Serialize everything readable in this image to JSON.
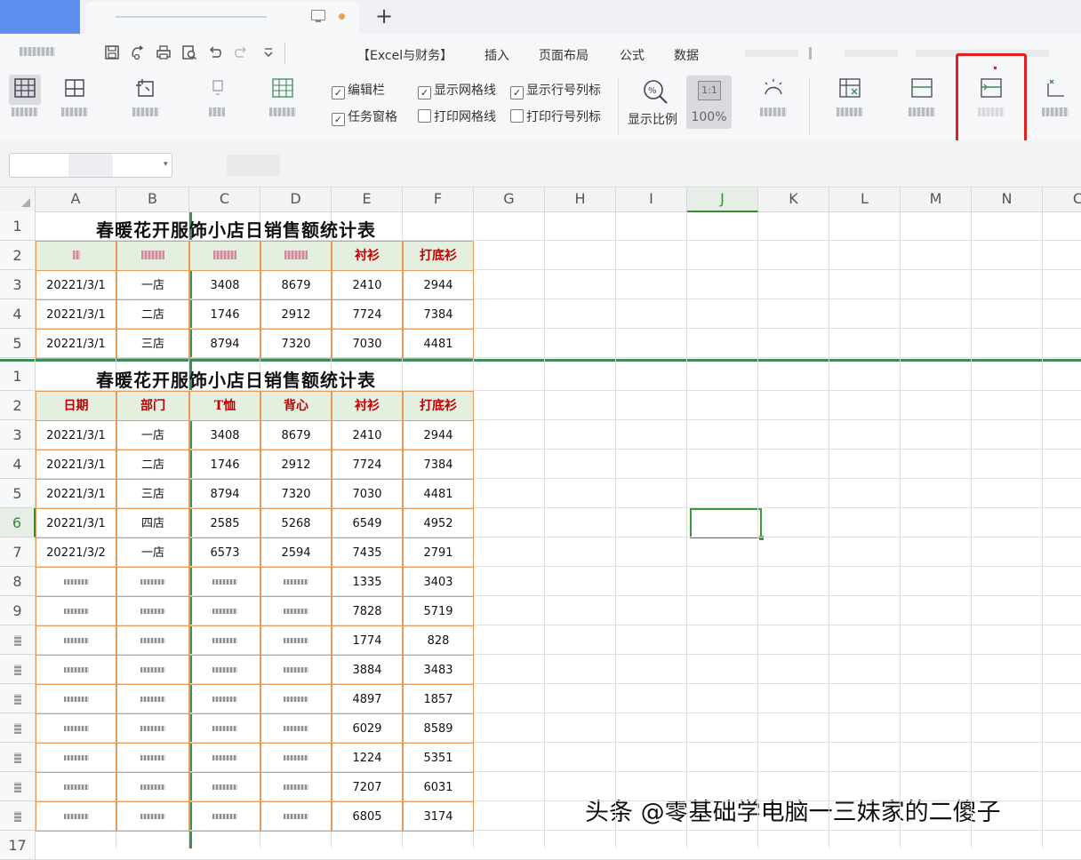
{
  "tabbar": {
    "new_tab": "+"
  },
  "menu": {
    "items": [
      "【Excel与财务】",
      "插入",
      "页面布局",
      "公式",
      "数据"
    ]
  },
  "view_options": {
    "edit_bar": "编辑栏",
    "task_pane": "任务窗格",
    "show_gridlines": "显示网格线",
    "print_gridlines": "打印网格线",
    "show_headers": "显示行号列标",
    "print_headers": "打印行号列标",
    "checked": {
      "edit_bar": true,
      "task_pane": true,
      "show_gridlines": true,
      "print_gridlines": false,
      "show_headers": true,
      "print_headers": false
    }
  },
  "zoom": {
    "ratio_label": "显示比例",
    "one_to_one": "1:1",
    "percent": "100%"
  },
  "columns": [
    "A",
    "B",
    "C",
    "D",
    "E",
    "F",
    "G",
    "H",
    "I",
    "J",
    "K",
    "L",
    "M",
    "N",
    "C"
  ],
  "selected_column": "J",
  "top_pane": {
    "rows": [
      "1",
      "2",
      "3",
      "4",
      "5"
    ],
    "title": "春暖花开服饰小店日销售额统计表",
    "header_visible": [
      "衬衫",
      "打底衫"
    ],
    "data": [
      [
        "20221/3/1",
        "一店",
        "3408",
        "8679",
        "2410",
        "2944"
      ],
      [
        "20221/3/1",
        "二店",
        "1746",
        "2912",
        "7724",
        "7384"
      ],
      [
        "20221/3/1",
        "三店",
        "8794",
        "7320",
        "7030",
        "4481"
      ]
    ]
  },
  "bottom_pane": {
    "rows": [
      "1",
      "2",
      "3",
      "4",
      "5",
      "6",
      "7",
      "8",
      "9",
      "",
      "",
      "",
      "",
      "",
      "",
      "",
      "17"
    ],
    "title": "春暖花开服饰小店日销售额统计表",
    "headers": [
      "日期",
      "部门",
      "T恤",
      "背心",
      "衬衫",
      "打底衫"
    ],
    "data": [
      [
        "20221/3/1",
        "一店",
        "3408",
        "8679",
        "2410",
        "2944"
      ],
      [
        "20221/3/1",
        "二店",
        "1746",
        "2912",
        "7724",
        "7384"
      ],
      [
        "20221/3/1",
        "三店",
        "8794",
        "7320",
        "7030",
        "4481"
      ],
      [
        "20221/3/1",
        "四店",
        "2585",
        "5268",
        "6549",
        "4952"
      ],
      [
        "20221/3/2",
        "一店",
        "6573",
        "2594",
        "7435",
        "2791"
      ]
    ],
    "partial_data": [
      [
        "1335",
        "3403"
      ],
      [
        "7828",
        "5719"
      ],
      [
        "1774",
        "828"
      ],
      [
        "3884",
        "3483"
      ],
      [
        "4897",
        "1857"
      ],
      [
        "6029",
        "8589"
      ],
      [
        "1224",
        "5351"
      ],
      [
        "7207",
        "6031"
      ],
      [
        "6805",
        "3174"
      ]
    ]
  },
  "selected_row": "6",
  "watermark": "头条 @零基础学电脑一三妹家的二傻子",
  "colors": {
    "accent_green": "#3e8e5a",
    "header_fill": "#e5efe0",
    "header_text": "#c00000",
    "border": "#e59b5a",
    "highlight": "#e02020"
  }
}
